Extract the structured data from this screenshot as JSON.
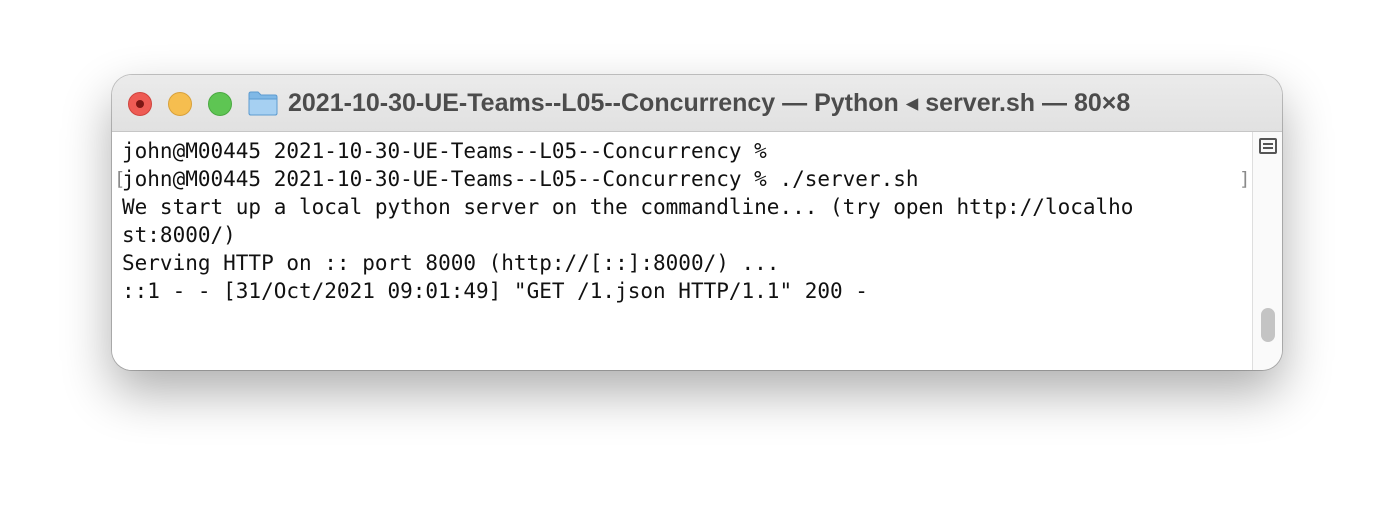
{
  "window": {
    "title": "2021-10-30-UE-Teams--L05--Concurrency — Python ◂ server.sh — 80×8",
    "controls": [
      "close",
      "minimize",
      "zoom"
    ],
    "title_icon": "folder-icon"
  },
  "terminal": {
    "lines": [
      "john@M00445 2021-10-30-UE-Teams--L05--Concurrency %",
      "john@M00445 2021-10-30-UE-Teams--L05--Concurrency % ./server.sh",
      "We start up a local python server on the commandline... (try open http://localho",
      "st:8000/)",
      "Serving HTTP on :: port 8000 (http://[::]:8000/) ...",
      "::1 - - [31/Oct/2021 09:01:49] \"GET /1.json HTTP/1.1\" 200 -"
    ],
    "mark_left": "[",
    "mark_right": "]"
  },
  "scrollbar": {
    "split_icon": "split-pane-icon"
  }
}
